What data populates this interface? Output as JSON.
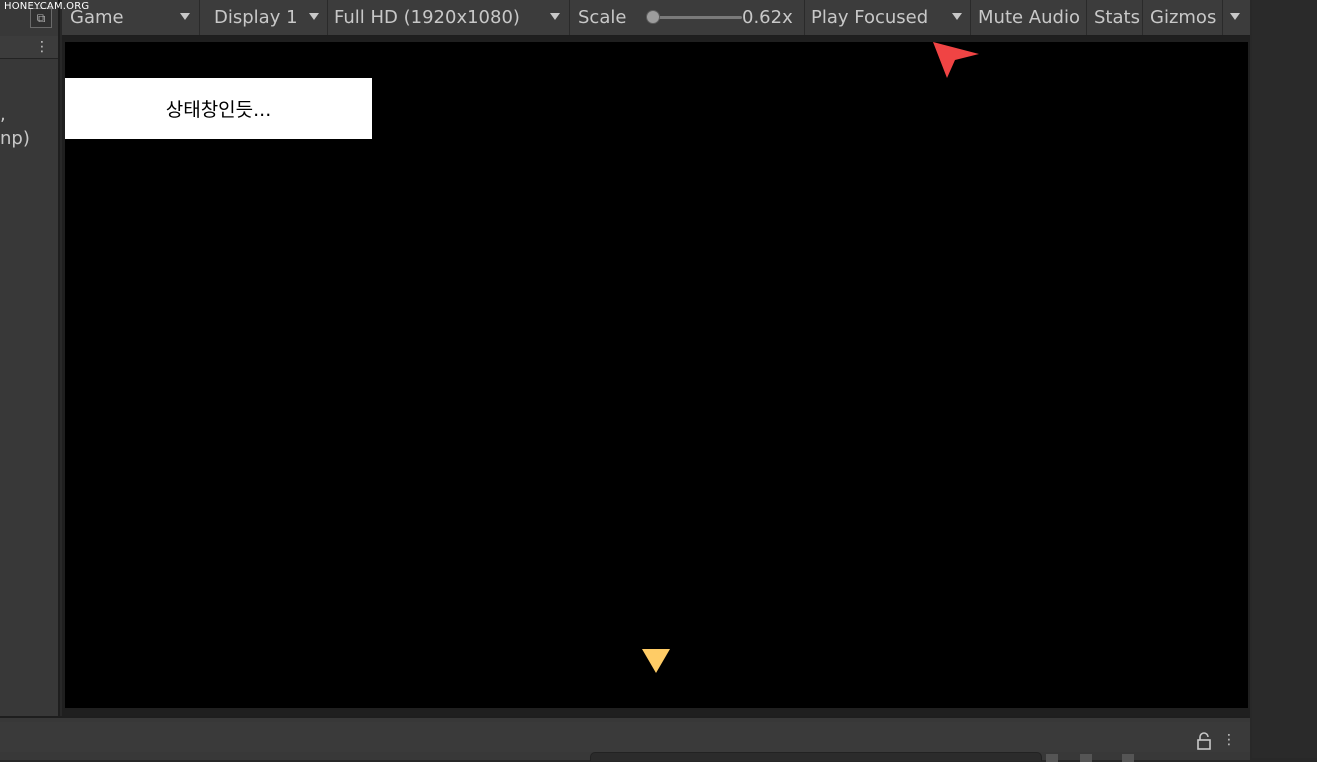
{
  "watermark": "HONEYCAM.ORG",
  "left_panel": {
    "text_fragments": [
      ",",
      "np)"
    ]
  },
  "toolbar": {
    "view_select": "Game",
    "display_select": "Display 1",
    "resolution_select": "Full HD (1920x1080)",
    "scale_label": "Scale",
    "scale_value": "0.62x",
    "play_mode_select": "Play Focused",
    "mute_audio": "Mute Audio",
    "stats": "Stats",
    "gizmos": "Gizmos"
  },
  "game": {
    "status_box_text": "상태창인듯...",
    "background_color": "#000000",
    "status_box_color": "#ffffff"
  },
  "colors": {
    "cursor_arrow": "#f04444",
    "marker_triangle": "#ffcc66",
    "toolbar_bg": "#3c3c3c",
    "panel_bg": "#383838"
  },
  "icons": {
    "maximize": "maximize-icon",
    "lock": "lock-icon",
    "menu": "kebab-menu-icon"
  }
}
